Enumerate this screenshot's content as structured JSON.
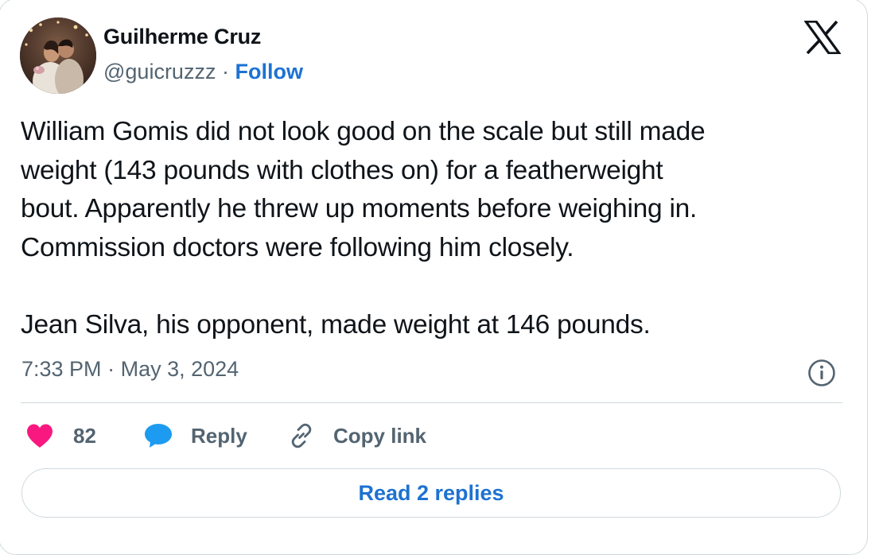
{
  "author": {
    "name": "Guilherme Cruz",
    "handle": "@guicruzzz",
    "separator": "·",
    "follow_label": "Follow"
  },
  "brand": {
    "logo_icon": "x-logo-icon"
  },
  "tweet": {
    "lines": [
      "William Gomis did not look good on the scale but still made",
      "weight (143 pounds with clothes on) for a featherweight",
      "bout. Apparently he threw up moments before weighing in.",
      "Commission doctors were following him closely.",
      "Jean Silva, his opponent, made weight at 146 pounds."
    ],
    "time": "7:33 PM",
    "separator": "·",
    "date": "May 3, 2024"
  },
  "actions": {
    "like_icon": "heart-icon",
    "like_count": "82",
    "reply_icon": "speech-bubble-icon",
    "reply_label": "Reply",
    "copy_icon": "link-icon",
    "copy_label": "Copy link",
    "info_icon": "info-icon"
  },
  "replies": {
    "button_label": "Read 2 replies"
  },
  "colors": {
    "accent": "#1d72d2",
    "like": "#f91880",
    "reply_icon": "#1d9bf0",
    "text_primary": "#0f1419",
    "text_secondary": "#536471",
    "border": "#cfd9de"
  }
}
